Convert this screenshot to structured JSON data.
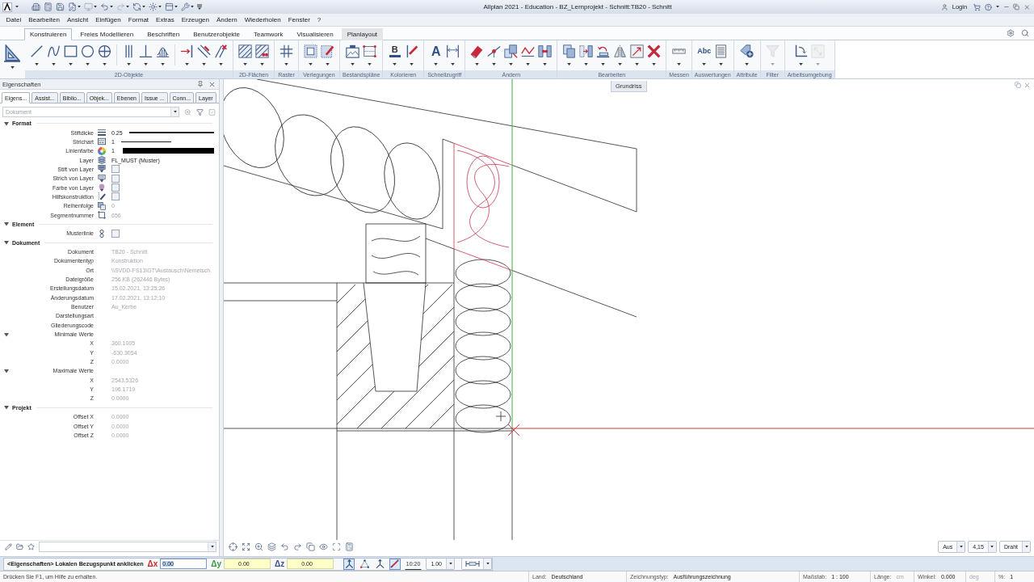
{
  "title_bar": {
    "title": "Allplan 2021 - Education - BZ_Lernprojekt - Schnitt:TB20 - Schnitt",
    "login": "Login"
  },
  "menu": [
    "Datei",
    "Bearbeiten",
    "Ansicht",
    "Einfügen",
    "Format",
    "Extras",
    "Erzeugen",
    "Ändern",
    "Wiederholen",
    "Fenster",
    "?"
  ],
  "ribbon": {
    "tabs": [
      {
        "label": "Konstruieren",
        "selected": true,
        "highlighted": false
      },
      {
        "label": "Freies Modellieren",
        "selected": false,
        "highlighted": false
      },
      {
        "label": "Beschriften",
        "selected": false,
        "highlighted": false
      },
      {
        "label": "Benutzerobjekte",
        "selected": false,
        "highlighted": false
      },
      {
        "label": "Teamwork",
        "selected": false,
        "highlighted": false
      },
      {
        "label": "Visualisieren",
        "selected": false,
        "highlighted": false
      },
      {
        "label": "Planlayout",
        "selected": false,
        "highlighted": true
      }
    ],
    "groups": [
      {
        "sets": [
          [
            {
              "kind": "settri",
              "disabled": false
            }
          ]
        ]
      },
      {
        "label": "2D-Objekte",
        "sets": [
          [
            {
              "kind": "line",
              "disabled": false
            },
            {
              "kind": "spline",
              "disabled": false
            },
            {
              "kind": "rectangle",
              "disabled": false
            },
            {
              "kind": "circle",
              "disabled": false
            },
            {
              "kind": "crosscircle",
              "disabled": false
            }
          ],
          [
            {
              "kind": "parallel",
              "disabled": false
            },
            {
              "kind": "perpendicular",
              "disabled": false
            },
            {
              "kind": "profile",
              "disabled": false
            }
          ],
          [
            {
              "kind": "extend",
              "disabled": false
            },
            {
              "kind": "split",
              "disabled": false
            },
            {
              "kind": "trim",
              "disabled": false
            }
          ]
        ]
      },
      {
        "label": "2D-Flächen",
        "sets": [
          [
            {
              "kind": "hatch",
              "disabled": false
            },
            {
              "kind": "pattern",
              "disabled": false
            }
          ]
        ]
      },
      {
        "label": "Raster",
        "sets": [
          [
            {
              "kind": "grid",
              "disabled": false
            }
          ]
        ]
      },
      {
        "label": "Verlegungen",
        "sets": [
          [
            {
              "kind": "tiles",
              "disabled": false
            },
            {
              "kind": "tilesedit",
              "disabled": false
            }
          ]
        ]
      },
      {
        "label": "Bestandspläne",
        "sets": [
          [
            {
              "kind": "picture",
              "disabled": false
            },
            {
              "kind": "frame",
              "disabled": false
            }
          ]
        ]
      },
      {
        "label": "Kolorieren",
        "sets": [
          [
            {
              "kind": "fill",
              "glyph": "B",
              "disabled": false
            },
            {
              "kind": "colorline",
              "disabled": false
            }
          ]
        ]
      },
      {
        "label": "Schnellzugriff",
        "sets": [
          [
            {
              "kind": "text",
              "glyph": "A",
              "disabled": false
            },
            {
              "kind": "dimension",
              "disabled": false
            }
          ]
        ]
      },
      {
        "label": "Ändern",
        "sets": [
          [
            {
              "kind": "eraser",
              "disabled": false
            },
            {
              "kind": "nodepoint",
              "disabled": false
            },
            {
              "kind": "copymove",
              "disabled": false
            },
            {
              "kind": "polyline",
              "disabled": false
            },
            {
              "kind": "join",
              "disabled": false
            }
          ]
        ]
      },
      {
        "label": "Bearbeiten",
        "sets": [
          [
            {
              "kind": "copy",
              "disabled": false
            },
            {
              "kind": "move",
              "disabled": false
            },
            {
              "kind": "rotate",
              "disabled": false
            },
            {
              "kind": "mirror",
              "disabled": false
            },
            {
              "kind": "scale",
              "disabled": false
            },
            {
              "kind": "delete",
              "disabled": false
            }
          ]
        ]
      },
      {
        "label": "Messen",
        "sets": [
          [
            {
              "kind": "ruler",
              "disabled": false
            }
          ]
        ]
      },
      {
        "label": "Auswertungen",
        "sets": [
          [
            {
              "kind": "labels",
              "glyph": "Abc",
              "disabled": false
            },
            {
              "kind": "report",
              "disabled": false
            }
          ]
        ]
      },
      {
        "label": "Attribute",
        "sets": [
          [
            {
              "kind": "tag",
              "disabled": false
            }
          ]
        ]
      },
      {
        "label": "Filter",
        "sets": [
          [
            {
              "kind": "filter",
              "disabled": true
            }
          ]
        ]
      },
      {
        "label": "Arbeitsumgebung",
        "sets": [
          [
            {
              "kind": "axes",
              "disabled": false
            },
            {
              "kind": "fit",
              "disabled": true
            }
          ]
        ]
      }
    ]
  },
  "properties": {
    "title": "Eigenschaften",
    "tabs": [
      {
        "label": "Eigens...",
        "selected": true
      },
      {
        "label": "Assist...",
        "selected": false
      },
      {
        "label": "Biblio...",
        "selected": false
      },
      {
        "label": "Objek...",
        "selected": false
      },
      {
        "label": "Ebenen",
        "selected": false
      },
      {
        "label": "Issue ...",
        "selected": false
      },
      {
        "label": "Conn...",
        "selected": false
      },
      {
        "label": "Layer",
        "selected": false
      }
    ],
    "filter": {
      "placeholder": "Dokument"
    },
    "sections": [
      {
        "title": "Format",
        "expanded": true,
        "rows": [
          {
            "kind": "pen",
            "label": "Stiftdicke",
            "value": "0.25",
            "disabled": false
          },
          {
            "kind": "stroke",
            "label": "Strichart",
            "value": "1",
            "disabled": false
          },
          {
            "kind": "color",
            "label": "Linienfarbe",
            "value": "1",
            "disabled": false,
            "color": "#000000"
          },
          {
            "kind": "layer",
            "label": "Layer",
            "value": "FL_MUST (Muster)",
            "disabled": false
          },
          {
            "kind": "penlayer",
            "label": "Stift von Layer",
            "checked": false
          },
          {
            "kind": "strokelayer",
            "label": "Strich von Layer",
            "checked": false
          },
          {
            "kind": "colorlayer",
            "label": "Farbe von Layer",
            "checked": false
          },
          {
            "kind": "helper",
            "label": "Hilfskonstruktion",
            "checked": false
          },
          {
            "kind": "order",
            "label": "Reihenfolge",
            "value": "0",
            "disabled": true
          },
          {
            "kind": "segment",
            "label": "Segmentnummer",
            "value": "656",
            "disabled": true
          }
        ]
      },
      {
        "title": "Element",
        "expanded": true,
        "rows": [
          {
            "kind": "pattern",
            "label": "Musterlinie",
            "checked": false
          }
        ]
      },
      {
        "title": "Dokument",
        "expanded": true,
        "rows": [
          {
            "kind": "info",
            "label": "Dokument",
            "value": "TB20 - Schnitt",
            "disabled": true
          },
          {
            "kind": "info",
            "label": "Dokumententyp",
            "value": "Konstruktion",
            "disabled": true
          },
          {
            "kind": "info",
            "label": "Ort",
            "value": "\\\\SVDD-FS13\\GT\\Austausch\\Nemetsch",
            "disabled": true
          },
          {
            "kind": "info",
            "label": "Dateigröße",
            "value": "256 KB (262446 Bytes)",
            "disabled": true
          },
          {
            "kind": "info",
            "label": "Erstellungsdatum",
            "value": "15.02.2021, 13:25:26",
            "disabled": true
          },
          {
            "kind": "info",
            "label": "Änderungsdatum",
            "value": "17.02.2021, 13:12:10",
            "disabled": true
          },
          {
            "kind": "info",
            "label": "Benutzer",
            "value": "Au_Kerbe",
            "disabled": true
          },
          {
            "kind": "info",
            "label": "Darstellungsart"
          },
          {
            "kind": "info",
            "label": "Gliederungscode"
          },
          {
            "kind": "group",
            "label": "Minimale Werte",
            "expanded": true,
            "children": [
              {
                "kind": "info",
                "label": "X",
                "value": "360.1005",
                "disabled": true
              },
              {
                "kind": "info",
                "label": "Y",
                "value": "-630.3054",
                "disabled": true
              },
              {
                "kind": "info",
                "label": "Z",
                "value": "0.0000",
                "disabled": true
              }
            ]
          },
          {
            "kind": "group",
            "label": "Maximale Werte",
            "expanded": true,
            "children": [
              {
                "kind": "info",
                "label": "X",
                "value": "2543.5326",
                "disabled": true
              },
              {
                "kind": "info",
                "label": "Y",
                "value": "196.1719",
                "disabled": true
              },
              {
                "kind": "info",
                "label": "Z",
                "value": "0.0000",
                "disabled": true
              }
            ]
          }
        ]
      },
      {
        "title": "Projekt",
        "expanded": true,
        "rows": [
          {
            "kind": "info",
            "label": "Offset X",
            "value": "0.0000",
            "disabled": true
          },
          {
            "kind": "info",
            "label": "Offset Y",
            "value": "0.0000",
            "disabled": true
          },
          {
            "kind": "info",
            "label": "Offset Z",
            "value": "0.0000",
            "disabled": true
          }
        ]
      }
    ]
  },
  "canvas": {
    "view_label": "Grundriss",
    "view_controls": [
      "Aus",
      "4,15",
      "Draht"
    ]
  },
  "input_line": {
    "prompt": "<Eigenschaften> Lokalen Bezugspunkt anklicken",
    "fields": [
      {
        "label": "Δx",
        "value": "0.00",
        "color": "#d02828",
        "focused": true
      },
      {
        "label": "Δy",
        "value": "0.00",
        "color": "#3c9a3c",
        "focused": false
      },
      {
        "label": "Δz",
        "value": "0.00",
        "color": "#3a4f8f",
        "focused": false
      }
    ],
    "tools": [
      {
        "kind": "axes",
        "selected": true
      },
      {
        "kind": "triangle",
        "selected": false
      },
      {
        "kind": "axes2",
        "selected": false
      },
      {
        "kind": "pen",
        "selected": true
      },
      {
        "kind": "ratio",
        "glyph": "10:20",
        "selected": false
      }
    ],
    "scale": "1.00"
  },
  "status_bar": {
    "hint": "Drücken Sie F1, um Hilfe zu erhalten.",
    "items": [
      {
        "label": "Land:",
        "value": "Deutschland",
        "disabled": false
      },
      {
        "label": "Zeichnungstyp:",
        "value": "Ausführungszeichnung",
        "disabled": false
      },
      {
        "label": "Maßstab:",
        "value": "1 : 100",
        "disabled": false
      },
      {
        "label": "Länge:",
        "value": "cm",
        "disabled": true
      },
      {
        "label": "Winkel:",
        "value": "0.000",
        "disabled": false
      },
      {
        "value": "deg",
        "disabled": true
      },
      {
        "label": "%:",
        "value": "1",
        "disabled": false
      }
    ]
  }
}
